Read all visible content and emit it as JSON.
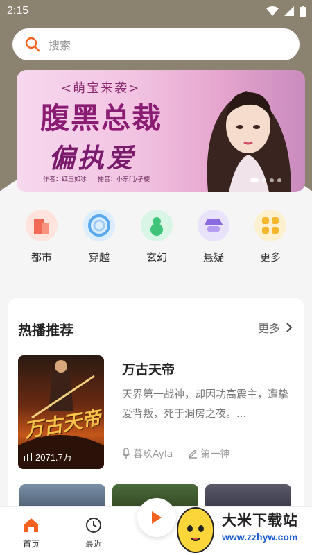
{
  "status_bar": {
    "time": "2:15"
  },
  "search": {
    "placeholder": "搜索"
  },
  "banner": {
    "tag": "<萌宝来袭>",
    "title_line1": "腹黑总裁",
    "title_line2": "偏执爱",
    "author": "作者：红玉如冰",
    "narrator": "播音：小东门/孑梗",
    "dots": 4,
    "active_dot": 0
  },
  "categories": [
    {
      "label": "都市",
      "icon": "city-building-icon",
      "color": "#f26a55"
    },
    {
      "label": "穿越",
      "icon": "swirl-portal-icon",
      "color": "#5aa8ee"
    },
    {
      "label": "玄幻",
      "icon": "gourd-icon",
      "color": "#3fc47a"
    },
    {
      "label": "悬疑",
      "icon": "detective-icon",
      "color": "#8a6ae0"
    },
    {
      "label": "更多",
      "icon": "grid-more-icon",
      "color": "#f6b730"
    }
  ],
  "hot_section": {
    "title": "热播推荐",
    "more_label": "更多",
    "featured": {
      "title": "万古天帝",
      "description": "天界第一战神，却因功高震主，遭挚爱背叛，死于洞房之夜。...",
      "plays": "2071.7万",
      "narrator": "暮玖Ayla",
      "chapter": "第一神",
      "cover_title": "万古天帝"
    }
  },
  "bottom_nav": [
    {
      "label": "首页",
      "icon": "home-icon",
      "active": true
    },
    {
      "label": "最近",
      "icon": "clock-icon",
      "active": false
    }
  ],
  "watermark": {
    "text": "大米下载站",
    "url": "www.zzhyw.com"
  },
  "colors": {
    "accent": "#f5611f",
    "header_bg": "#8b8270"
  }
}
